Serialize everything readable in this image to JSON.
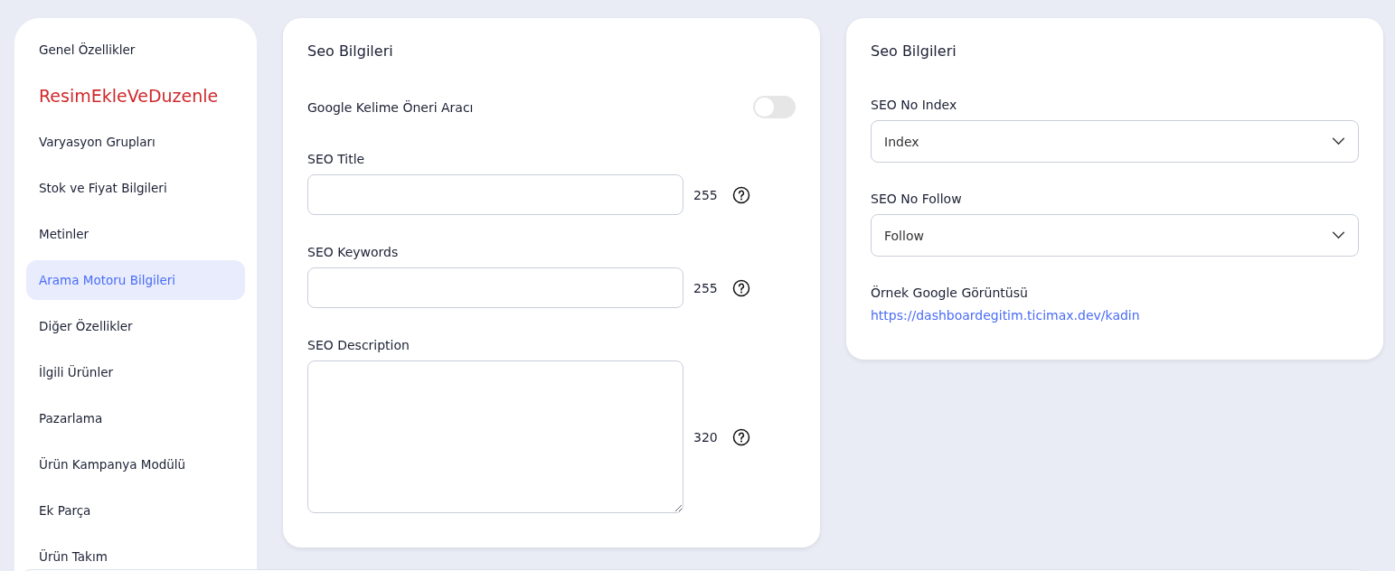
{
  "sidebar": {
    "items": [
      {
        "label": "Genel Özellikler",
        "kind": "plain",
        "selected": false
      },
      {
        "label": "ResimEkleVeDuzenle",
        "kind": "alert",
        "selected": false
      },
      {
        "label": "Varyasyon Grupları",
        "kind": "plain",
        "selected": false
      },
      {
        "label": "Stok ve Fiyat Bilgileri",
        "kind": "plain",
        "selected": false
      },
      {
        "label": "Metinler",
        "kind": "plain",
        "selected": false
      },
      {
        "label": "Arama Motoru Bilgileri",
        "kind": "plain",
        "selected": true
      },
      {
        "label": "Diğer Özellikler",
        "kind": "plain",
        "selected": false
      },
      {
        "label": "İlgili Ürünler",
        "kind": "plain",
        "selected": false
      },
      {
        "label": "Pazarlama",
        "kind": "plain",
        "selected": false
      },
      {
        "label": "Ürün Kampanya Modülü",
        "kind": "plain",
        "selected": false
      },
      {
        "label": "Ek Parça",
        "kind": "plain",
        "selected": false
      },
      {
        "label": "Ürün Takım",
        "kind": "plain",
        "selected": false
      }
    ]
  },
  "seo_card": {
    "title": "Seo Bilgileri",
    "toggle": {
      "label": "Google Kelime Öneri Aracı",
      "on": false
    },
    "fields": [
      {
        "label": "SEO Title",
        "kind": "input",
        "count": "255"
      },
      {
        "label": "SEO Keywords",
        "kind": "input",
        "count": "255"
      },
      {
        "label": "SEO Description",
        "kind": "textarea",
        "count": "320"
      }
    ]
  },
  "seo_side_card": {
    "title": "Seo Bilgileri",
    "selects": [
      {
        "label": "SEO No Index",
        "value": "Index"
      },
      {
        "label": "SEO No Follow",
        "value": "Follow"
      }
    ],
    "preview": {
      "label": "Örnek Google Görüntüsü",
      "url": "https://dashboardegitim.ticimax.dev/kadin"
    }
  }
}
